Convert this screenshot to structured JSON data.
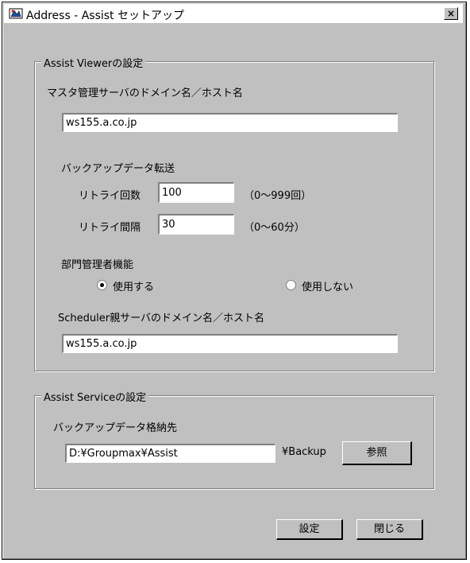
{
  "window": {
    "title": "Address - Assist セットアップ",
    "close_label": "×"
  },
  "viewer_group": {
    "legend": "Assist Viewerの設定",
    "master_host_label": "マスタ管理サーバのドメイン名／ホスト名",
    "master_host_value": "ws155.a.co.jp",
    "backup_transfer_label": "バックアップデータ転送",
    "retry_count_label": "リトライ回数",
    "retry_count_value": "100",
    "retry_count_range": "（0～999回）",
    "retry_interval_label": "リトライ間隔",
    "retry_interval_value": "30",
    "retry_interval_range": "（0～60分）",
    "dept_admin_label": "部門管理者機能",
    "use_label": "使用する",
    "not_use_label": "使用しない",
    "use_selected": true,
    "scheduler_host_label": "Scheduler親サーバのドメイン名／ホスト名",
    "scheduler_host_value": "ws155.a.co.jp"
  },
  "service_group": {
    "legend": "Assist Serviceの設定",
    "backup_dest_label": "バックアップデータ格納先",
    "backup_dest_value": "D:¥Groupmax¥Assist",
    "backup_suffix": "¥Backup",
    "browse_label": "参照"
  },
  "footer": {
    "ok_label": "設定",
    "close_label": "閉じる"
  }
}
